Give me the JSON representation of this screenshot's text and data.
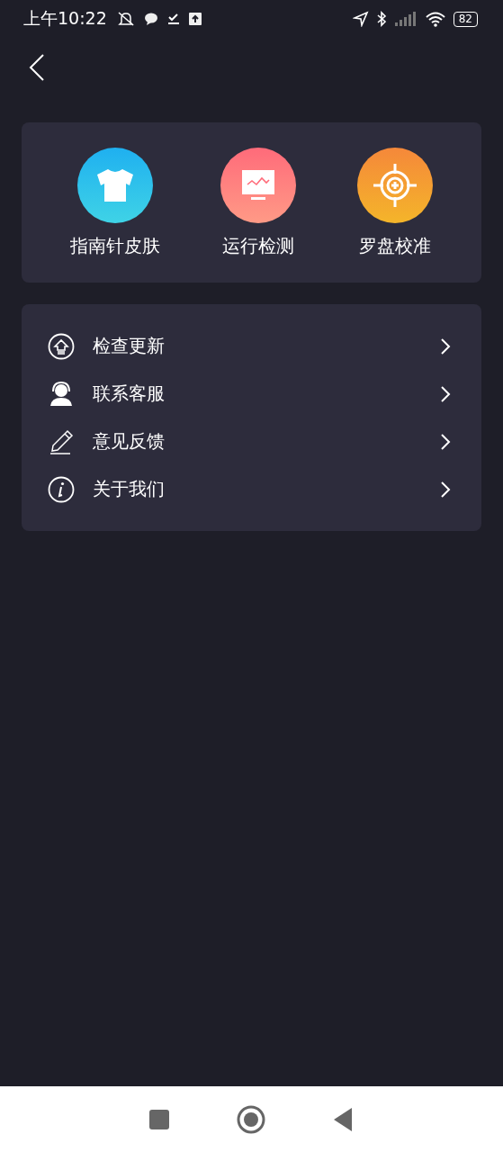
{
  "status_bar": {
    "time": "上午10:22",
    "battery": "82"
  },
  "shortcuts": [
    {
      "kind": "skin",
      "label": "指南针皮肤"
    },
    {
      "kind": "monitor",
      "label": "运行检测"
    },
    {
      "kind": "target",
      "label": "罗盘校准"
    }
  ],
  "menu": [
    {
      "kind": "update",
      "label": "检查更新"
    },
    {
      "kind": "service",
      "label": "联系客服"
    },
    {
      "kind": "feedback",
      "label": "意见反馈"
    },
    {
      "kind": "about",
      "label": "关于我们"
    }
  ]
}
